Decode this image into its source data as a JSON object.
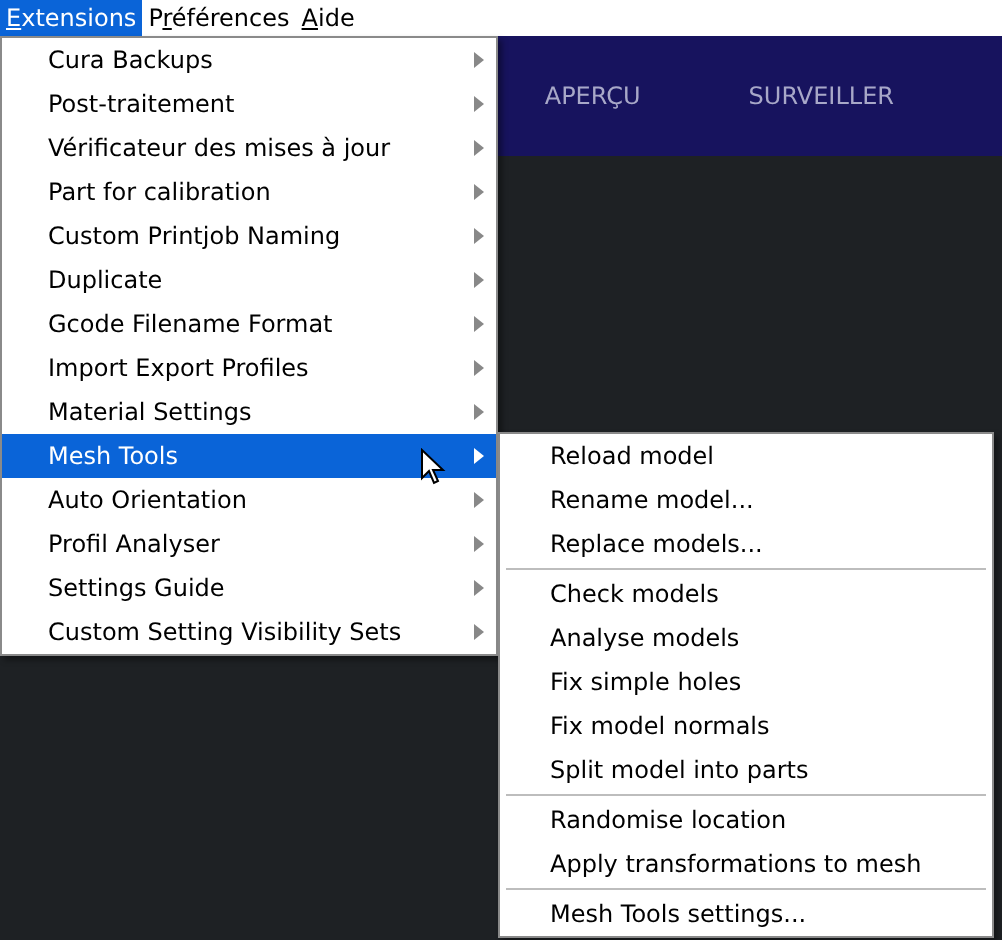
{
  "menubar": [
    {
      "key": "E",
      "suffix": "xtensions",
      "selected": true
    },
    {
      "prefix": "P",
      "key": "r",
      "suffix": "éférences",
      "selected": false
    },
    {
      "key": "A",
      "suffix": "ide",
      "selected": false
    }
  ],
  "header": {
    "tabs": [
      {
        "label": "APERÇU"
      },
      {
        "label": "SURVEILLER"
      }
    ]
  },
  "menu": [
    {
      "label": "Cura Backups",
      "selected": false
    },
    {
      "label": "Post-traitement",
      "selected": false
    },
    {
      "label": "Vérificateur des mises à jour",
      "selected": false
    },
    {
      "label": "Part for calibration",
      "selected": false
    },
    {
      "label": "Custom Printjob Naming",
      "selected": false
    },
    {
      "label": "Duplicate",
      "selected": false
    },
    {
      "label": "Gcode Filename Format",
      "selected": false
    },
    {
      "label": "Import Export Profiles",
      "selected": false
    },
    {
      "label": "Material Settings",
      "selected": false
    },
    {
      "label": "Mesh Tools",
      "selected": true
    },
    {
      "label": "Auto Orientation",
      "selected": false
    },
    {
      "label": "Profil Analyser",
      "selected": false
    },
    {
      "label": "Settings Guide",
      "selected": false
    },
    {
      "label": "Custom Setting Visibility Sets",
      "selected": false
    }
  ],
  "submenu": [
    {
      "kind": "item",
      "label": "Reload model"
    },
    {
      "kind": "item",
      "label": "Rename model..."
    },
    {
      "kind": "item",
      "label": "Replace models..."
    },
    {
      "kind": "separator"
    },
    {
      "kind": "item",
      "label": "Check models"
    },
    {
      "kind": "item",
      "label": "Analyse models"
    },
    {
      "kind": "item",
      "label": "Fix simple holes"
    },
    {
      "kind": "item",
      "label": "Fix model normals"
    },
    {
      "kind": "item",
      "label": "Split model into parts"
    },
    {
      "kind": "separator"
    },
    {
      "kind": "item",
      "label": "Randomise location"
    },
    {
      "kind": "item",
      "label": "Apply transformations to mesh"
    },
    {
      "kind": "separator"
    },
    {
      "kind": "item",
      "label": "Mesh Tools settings..."
    }
  ]
}
